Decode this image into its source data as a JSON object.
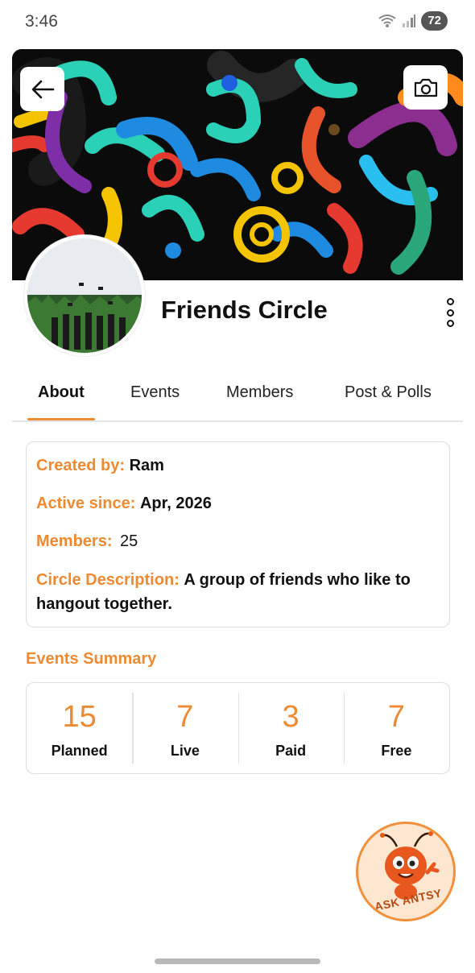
{
  "status_bar": {
    "time": "3:46",
    "battery": "72",
    "wifi_icon": "wifi-icon",
    "signal_icon": "signal-icon"
  },
  "header": {
    "back_icon": "arrow-left-icon",
    "camera_icon": "camera-icon"
  },
  "circle": {
    "name": "Friends Circle",
    "menu_icon": "more-vertical-icon"
  },
  "tabs": [
    {
      "label": "About",
      "active": true
    },
    {
      "label": "Events",
      "active": false
    },
    {
      "label": "Members",
      "active": false
    },
    {
      "label": "Post & Polls",
      "active": false
    }
  ],
  "about": {
    "created_by_label": "Created by:",
    "created_by_value": "Ram",
    "active_since_label": "Active since:",
    "active_since_value": "Apr, 2026",
    "members_label": "Members:",
    "members_value": "25",
    "description_label": "Circle Description:",
    "description_value": "A group of friends who like to hangout together."
  },
  "events_summary": {
    "title": "Events Summary",
    "items": [
      {
        "value": "15",
        "label": "Planned"
      },
      {
        "value": "7",
        "label": "Live"
      },
      {
        "value": "3",
        "label": "Paid"
      },
      {
        "value": "7",
        "label": "Free"
      }
    ]
  },
  "assistant": {
    "label": "ASK ANTSY"
  },
  "colors": {
    "accent": "#ee8a32",
    "text": "#111111",
    "border": "#dedede"
  }
}
